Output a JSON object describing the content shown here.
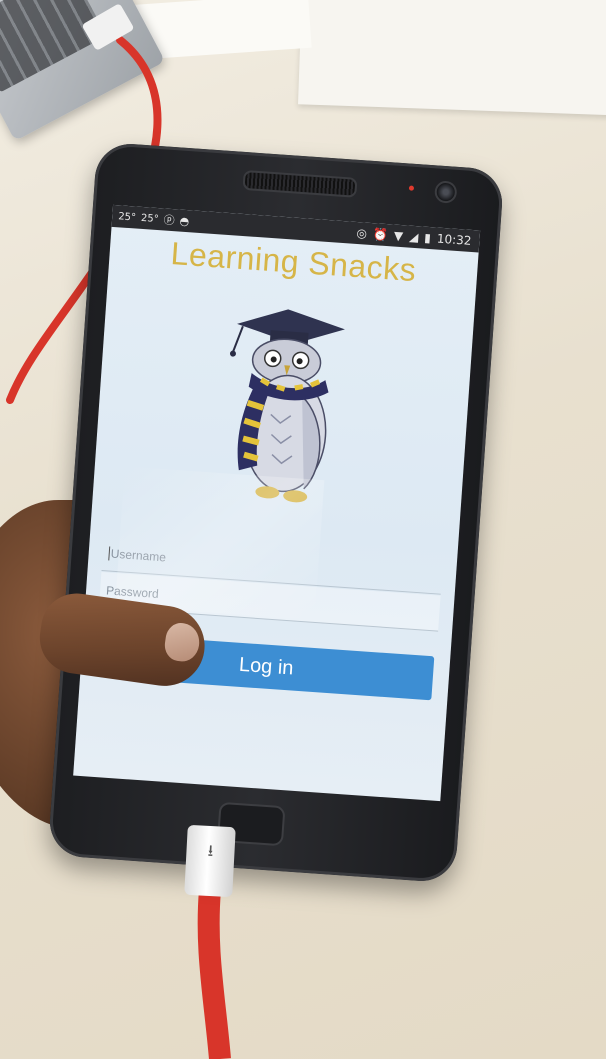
{
  "app": {
    "title": "Learning Snacks"
  },
  "status_bar": {
    "left_items": [
      "25°",
      "25°"
    ],
    "time": "10:32"
  },
  "login_form": {
    "username_placeholder": "Username",
    "password_placeholder": "Password",
    "login_label": "Log in"
  },
  "colors": {
    "title": "#d6b548",
    "login_button": "#3d8ed3",
    "screen_bg": "#e4eef6"
  },
  "icons": {
    "logo": "owl-graduate-icon",
    "usb": "usb-icon"
  }
}
